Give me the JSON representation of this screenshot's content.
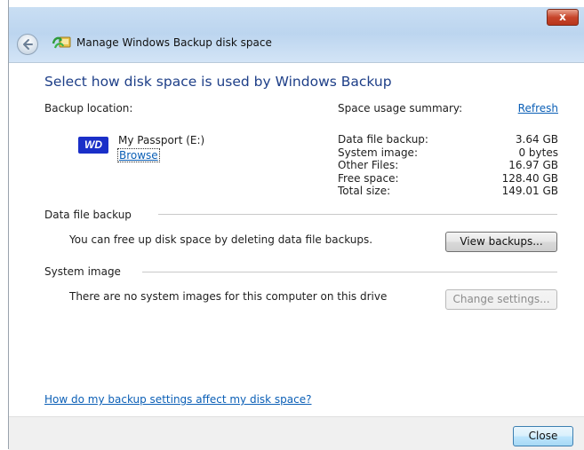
{
  "window": {
    "title": "Manage Windows Backup disk space",
    "close_glyph": "x"
  },
  "heading": "Select how disk space is used by Windows Backup",
  "backup_location": {
    "label": "Backup location:",
    "drive_name": "My Passport (E:)",
    "drive_icon": "wd-drive-icon",
    "logo_text": "WD",
    "browse_label": "Browse"
  },
  "summary": {
    "label": "Space usage summary:",
    "refresh_label": "Refresh",
    "rows": [
      {
        "key": "Data file backup:",
        "value": "3.64 GB"
      },
      {
        "key": "System image:",
        "value": "0 bytes"
      },
      {
        "key": "Other Files:",
        "value": "16.97 GB"
      },
      {
        "key": "Free space:",
        "value": "128.40 GB"
      },
      {
        "key": "Total size:",
        "value": "149.01 GB"
      }
    ]
  },
  "data_file_backup": {
    "section_label": "Data file backup",
    "description": "You can free up disk space by deleting data file backups.",
    "button_label": "View backups..."
  },
  "system_image": {
    "section_label": "System image",
    "description": "There are no system images for this computer on this drive",
    "button_label": "Change settings..."
  },
  "help_link": "How do my backup settings affect my disk space?",
  "footer": {
    "close_label": "Close"
  },
  "colors": {
    "heading": "#1e3f88",
    "link": "#0b5fb6",
    "titlebar": "#bcd5ef",
    "wd_blue": "#1a2fc8"
  }
}
